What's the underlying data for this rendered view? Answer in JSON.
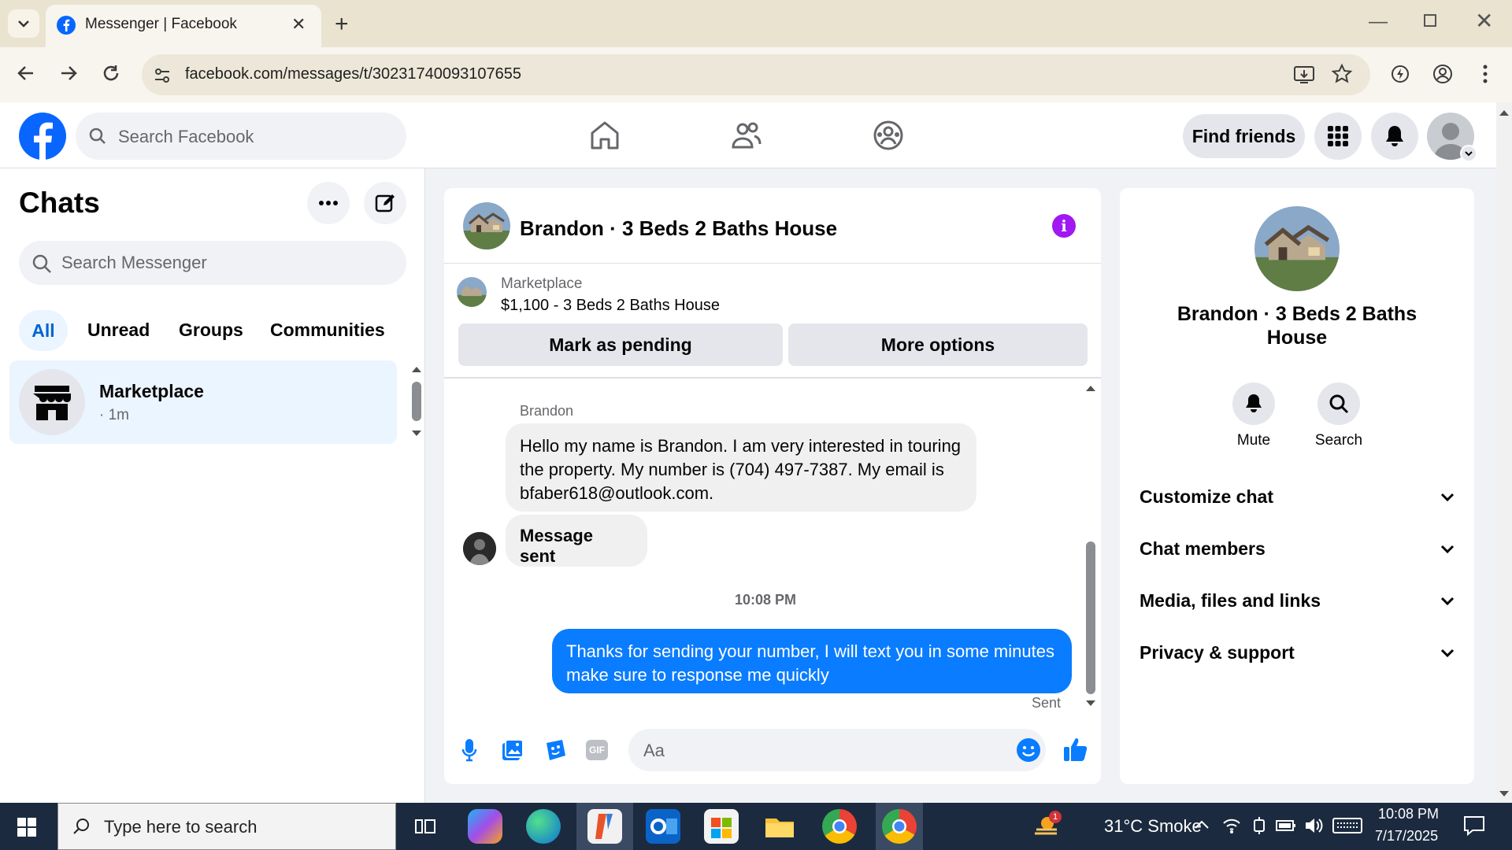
{
  "browser": {
    "tab_title": "Messenger | Facebook",
    "url": "facebook.com/messages/t/30231740093107655"
  },
  "fb": {
    "search_placeholder": "Search Facebook",
    "find_friends": "Find friends"
  },
  "chats": {
    "title": "Chats",
    "search_placeholder": "Search Messenger",
    "filters": [
      "All",
      "Unread",
      "Groups",
      "Communities"
    ],
    "conversation": {
      "name": "Marketplace",
      "time": "· 1m"
    }
  },
  "chat": {
    "title": "Brandon · 3 Beds 2 Baths House",
    "listing_label": "Marketplace",
    "listing": "$1,100 - 3 Beds 2 Baths House",
    "mark_pending": "Mark as pending",
    "more_options": "More options",
    "sender": "Brandon",
    "incoming": "Hello my name is Brandon. I am very interested in touring the property. My number is (704) 497-7387. My email is bfaber618@outlook.com.",
    "incoming_2": "Message sent",
    "time": "10:08 PM",
    "outgoing": "Thanks for sending your number, I will text you in some minutes make sure to response me quickly",
    "status": "Sent",
    "composer_placeholder": "Aa"
  },
  "details": {
    "name": "Brandon · 3 Beds 2 Baths House",
    "mute": "Mute",
    "search": "Search",
    "sections": [
      "Customize chat",
      "Chat members",
      "Media, files and links",
      "Privacy & support"
    ]
  },
  "taskbar": {
    "search_placeholder": "Type here to search",
    "weather": "31°C  Smoke",
    "weather_badge": "1",
    "time": "10:08 PM",
    "date": "7/17/2025"
  },
  "colors": {
    "fb_blue": "#0866ff",
    "bubble_out": "#0a7cff",
    "info_purple": "#a019f2"
  }
}
